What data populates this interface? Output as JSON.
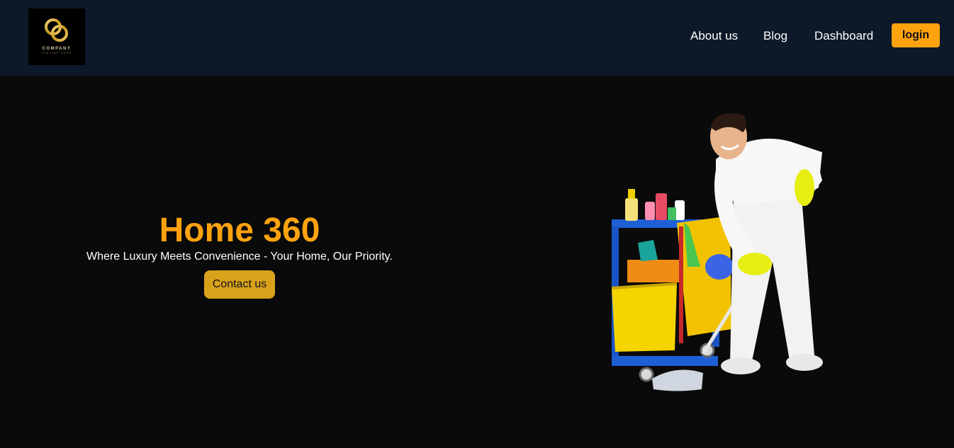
{
  "header": {
    "logo": {
      "icon": "company-logo-rings",
      "text": "COMPANY",
      "tagline": "TAGLINE HERE"
    },
    "nav": {
      "about_label": "About us",
      "blog_label": "Blog",
      "dashboard_label": "Dashboard",
      "login_label": "login"
    }
  },
  "hero": {
    "title": "Home 360",
    "subtitle": "Where Luxury Meets Convenience - Your Home, Our Priority.",
    "contact_label": "Contact us",
    "image_icon": "cleaner-with-cart-illustration"
  },
  "colors": {
    "nav_background": "#0d1828",
    "page_background": "#0a0a0a",
    "accent": "#ffa20f",
    "contact_button": "#d9a21d"
  }
}
